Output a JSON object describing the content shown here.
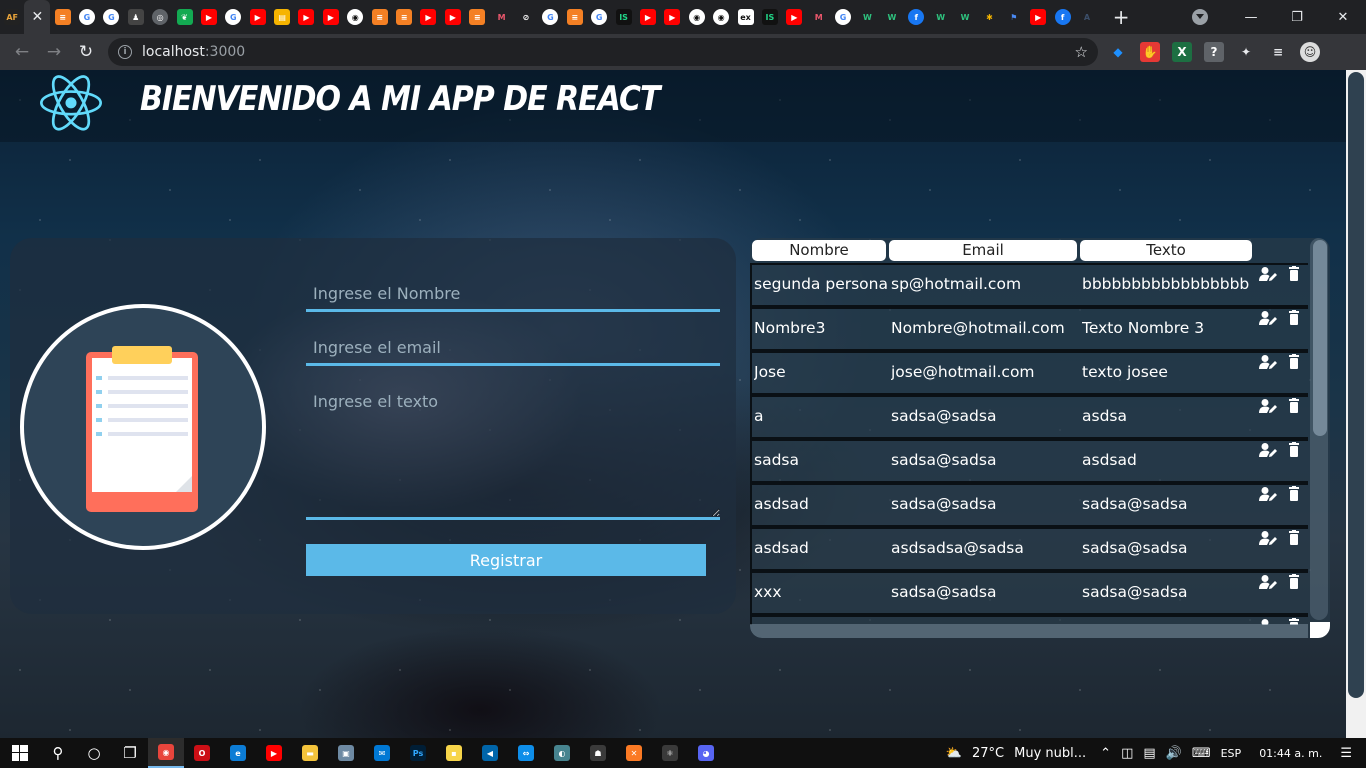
{
  "browser": {
    "tabs": [
      {
        "icon": "af-icon",
        "label": "AF",
        "color": "#222222",
        "fg": "#e8a33a"
      },
      {
        "icon": "close-icon",
        "label": "✕",
        "color": "#35363a",
        "fg": "#e8eaed",
        "active": true
      },
      {
        "icon": "stackoverflow-icon",
        "label": "≡",
        "color": "#f48024"
      },
      {
        "icon": "google-icon",
        "label": "G",
        "color": "#ffffff",
        "fg": "#4285f4",
        "round": true
      },
      {
        "icon": "google-icon",
        "label": "G",
        "color": "#ffffff",
        "fg": "#4285f4",
        "round": true
      },
      {
        "icon": "person-icon",
        "label": "♟",
        "color": "#444444"
      },
      {
        "icon": "globe-icon",
        "label": "◎",
        "color": "#5f6368",
        "round": true
      },
      {
        "icon": "mongodb-icon",
        "label": "❦",
        "color": "#13aa52"
      },
      {
        "icon": "youtube-icon",
        "label": "▶",
        "color": "#ff0000"
      },
      {
        "icon": "google-icon",
        "label": "G",
        "color": "#ffffff",
        "fg": "#4285f4",
        "round": true
      },
      {
        "icon": "youtube-icon",
        "label": "▶",
        "color": "#ff0000"
      },
      {
        "icon": "slides-icon",
        "label": "▤",
        "color": "#f6b400"
      },
      {
        "icon": "youtube-icon",
        "label": "▶",
        "color": "#ff0000"
      },
      {
        "icon": "youtube-icon",
        "label": "▶",
        "color": "#ff0000"
      },
      {
        "icon": "github-icon",
        "label": "◉",
        "color": "#ffffff",
        "fg": "#111",
        "round": true
      },
      {
        "icon": "stackoverflow-icon",
        "label": "≡",
        "color": "#f48024"
      },
      {
        "icon": "stackoverflow-icon",
        "label": "≡",
        "color": "#f48024"
      },
      {
        "icon": "youtube-icon",
        "label": "▶",
        "color": "#ff0000"
      },
      {
        "icon": "youtube-icon",
        "label": "▶",
        "color": "#ff0000"
      },
      {
        "icon": "stackoverflow-icon",
        "label": "≡",
        "color": "#f48024"
      },
      {
        "icon": "medium-icon",
        "label": "M",
        "color": "#202124",
        "fg": "#e8566b"
      },
      {
        "icon": "link-icon",
        "label": "⊘",
        "color": "#202124",
        "fg": "#ffffff"
      },
      {
        "icon": "google-icon",
        "label": "G",
        "color": "#ffffff",
        "fg": "#4285f4",
        "round": true
      },
      {
        "icon": "stackoverflow-icon",
        "label": "≡",
        "color": "#f48024"
      },
      {
        "icon": "google-icon",
        "label": "G",
        "color": "#ffffff",
        "fg": "#4285f4",
        "round": true
      },
      {
        "icon": "jetbrains-icon",
        "label": "IS",
        "color": "#111111",
        "fg": "#21d789"
      },
      {
        "icon": "youtube-icon",
        "label": "▶",
        "color": "#ff0000"
      },
      {
        "icon": "youtube-icon",
        "label": "▶",
        "color": "#ff0000"
      },
      {
        "icon": "github-icon",
        "label": "◉",
        "color": "#ffffff",
        "fg": "#111",
        "round": true
      },
      {
        "icon": "github-icon",
        "label": "◉",
        "color": "#ffffff",
        "fg": "#111",
        "round": true
      },
      {
        "icon": "ex-icon",
        "label": "ex",
        "color": "#ffffff",
        "fg": "#111"
      },
      {
        "icon": "jetbrains-icon",
        "label": "IS",
        "color": "#111111",
        "fg": "#21d789"
      },
      {
        "icon": "youtube-icon",
        "label": "▶",
        "color": "#ff0000"
      },
      {
        "icon": "medium-icon",
        "label": "M",
        "color": "#202124",
        "fg": "#e8566b"
      },
      {
        "icon": "google-icon",
        "label": "G",
        "color": "#ffffff",
        "fg": "#4285f4",
        "round": true
      },
      {
        "icon": "wordpress-icon",
        "label": "W",
        "color": "#202124",
        "fg": "#2ec27e"
      },
      {
        "icon": "wordpress-icon",
        "label": "W",
        "color": "#202124",
        "fg": "#2ec27e"
      },
      {
        "icon": "facebook-icon",
        "label": "f",
        "color": "#1877f2",
        "round": true
      },
      {
        "icon": "wordpress-icon",
        "label": "W",
        "color": "#202124",
        "fg": "#2ec27e"
      },
      {
        "icon": "wordpress-icon",
        "label": "W",
        "color": "#202124",
        "fg": "#2ec27e"
      },
      {
        "icon": "colorful-icon",
        "label": "✱",
        "color": "#202124",
        "fg": "#f4b400"
      },
      {
        "icon": "flag-icon",
        "label": "⚑",
        "color": "#202124",
        "fg": "#4a8af4"
      },
      {
        "icon": "youtube-icon",
        "label": "▶",
        "color": "#ff0000"
      },
      {
        "icon": "facebook-icon",
        "label": "f",
        "color": "#1877f2",
        "round": true
      },
      {
        "icon": "a-icon",
        "label": "A",
        "color": "#202124",
        "fg": "#3c4f6a"
      }
    ],
    "address": {
      "host": "localhost",
      "port": ":3000"
    },
    "extensions": [
      {
        "icon": "gem-icon",
        "label": "◆",
        "color": "#35363a",
        "fg": "#1e90ff"
      },
      {
        "icon": "stop-hand-icon",
        "label": "✋",
        "color": "#e53935"
      },
      {
        "icon": "excel-icon",
        "label": "X",
        "color": "#1d6f42"
      },
      {
        "icon": "help-icon",
        "label": "?",
        "color": "#5f6368"
      },
      {
        "icon": "puzzle-icon",
        "label": "✦",
        "color": "#35363a",
        "fg": "#e8eaed"
      },
      {
        "icon": "media-icon",
        "label": "≡",
        "color": "#35363a",
        "fg": "#e8eaed"
      },
      {
        "icon": "profile-avatar-icon",
        "label": "☺",
        "color": "#dddddd",
        "fg": "#333"
      }
    ]
  },
  "app": {
    "title": "Bienvenido a mi app de React",
    "form": {
      "name_placeholder": "Ingrese el Nombre",
      "email_placeholder": "Ingrese el email",
      "text_placeholder": "Ingrese el texto",
      "submit_label": "Registrar"
    },
    "table": {
      "headers": [
        "Nombre",
        "Email",
        "Texto"
      ],
      "rows": [
        {
          "nombre": "segunda persona",
          "email": "sp@hotmail.com",
          "texto": "bbbbbbbbbbbbbbbbb"
        },
        {
          "nombre": "Nombre3",
          "email": "Nombre@hotmail.com",
          "texto": "Texto Nombre 3"
        },
        {
          "nombre": "Jose",
          "email": "jose@hotmail.com",
          "texto": "texto josee"
        },
        {
          "nombre": "a",
          "email": "sadsa@sadsa",
          "texto": "asdsa"
        },
        {
          "nombre": "sadsa",
          "email": "sadsa@sadsa",
          "texto": "asdsad"
        },
        {
          "nombre": "asdsad",
          "email": "sadsa@sadsa",
          "texto": "sadsa@sadsa"
        },
        {
          "nombre": "asdsad",
          "email": "asdsadsa@sadsa",
          "texto": "sadsa@sadsa"
        },
        {
          "nombre": "xxx",
          "email": "sadsa@sadsa",
          "texto": "sadsa@sadsa"
        },
        {
          "nombre": "",
          "email": "",
          "texto": ""
        }
      ]
    },
    "colors": {
      "accent": "#5bb9e8",
      "react": "#61dafb"
    }
  },
  "taskbar": {
    "apps": [
      {
        "icon": "search-icon",
        "label": "⚲",
        "color": "transparent"
      },
      {
        "icon": "cortana-icon",
        "label": "○",
        "color": "transparent"
      },
      {
        "icon": "task-view-icon",
        "label": "❐",
        "color": "transparent"
      },
      {
        "icon": "chrome-icon",
        "label": "◉",
        "color": "#e8453c",
        "active": true
      },
      {
        "icon": "opera-icon",
        "label": "O",
        "color": "#cc0f16"
      },
      {
        "icon": "edge-icon",
        "label": "e",
        "color": "#0c7cd5"
      },
      {
        "icon": "youtube-icon",
        "label": "▶",
        "color": "#ff0000"
      },
      {
        "icon": "folder-icon",
        "label": "▬",
        "color": "#f3c33b"
      },
      {
        "icon": "photos-icon",
        "label": "▣",
        "color": "#6e8aa3"
      },
      {
        "icon": "mail-icon",
        "label": "✉",
        "color": "#0078d4"
      },
      {
        "icon": "photoshop-icon",
        "label": "Ps",
        "color": "#001e36",
        "fg": "#31a8ff"
      },
      {
        "icon": "sticky-notes-icon",
        "label": "▪",
        "color": "#f7d54a"
      },
      {
        "icon": "vscode-icon",
        "label": "◀",
        "color": "#0065a9"
      },
      {
        "icon": "teamviewer-icon",
        "label": "⇔",
        "color": "#0e8ee9"
      },
      {
        "icon": "electron-icon",
        "label": "◐",
        "color": "#47848f"
      },
      {
        "icon": "bot-icon",
        "label": "☗",
        "color": "#3a3a3a"
      },
      {
        "icon": "xampp-icon",
        "label": "✕",
        "color": "#fb7a24"
      },
      {
        "icon": "react-devtools-icon",
        "label": "⚛",
        "color": "#3a3a3a"
      },
      {
        "icon": "discord-icon",
        "label": "◕",
        "color": "#5865f2"
      }
    ],
    "weather": {
      "temp": "27°C",
      "desc": "Muy nubl..."
    },
    "language": "ESP",
    "time": "01:44 a. m."
  }
}
